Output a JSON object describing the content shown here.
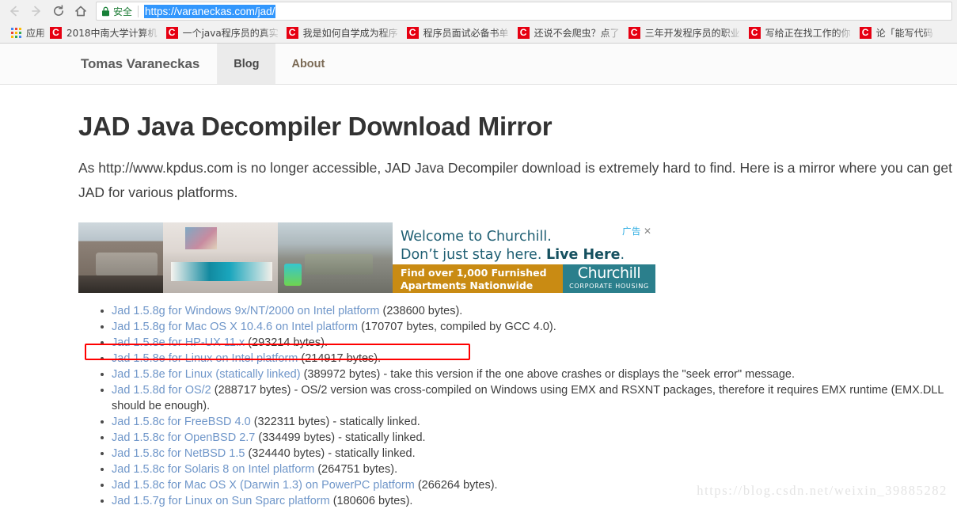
{
  "browser": {
    "toolbar": {
      "back_icon": "back-arrow-icon",
      "forward_icon": "forward-arrow-icon",
      "reload_icon": "reload-icon",
      "home_icon": "home-icon"
    },
    "omnibox": {
      "lock_icon": "lock-icon",
      "security_label": "安全",
      "url": "https://varaneckas.com/jad/",
      "url_selected": true
    },
    "bookmarks_bar": {
      "apps_icon": "apps-grid-icon",
      "apps_label": "应用",
      "items": [
        {
          "icon": "csdn-icon",
          "icon_letter": "C",
          "label": "2018中南大学计算机"
        },
        {
          "icon": "csdn-icon",
          "icon_letter": "C",
          "label": "一个java程序员的真实"
        },
        {
          "icon": "csdn-icon",
          "icon_letter": "C",
          "label": "我是如何自学成为程序"
        },
        {
          "icon": "csdn-icon",
          "icon_letter": "C",
          "label": "程序员面试必备书单"
        },
        {
          "icon": "csdn-icon",
          "icon_letter": "C",
          "label": "还说不会爬虫？点了"
        },
        {
          "icon": "csdn-icon",
          "icon_letter": "C",
          "label": "三年开发程序员的职业"
        },
        {
          "icon": "csdn-icon",
          "icon_letter": "C",
          "label": "写给正在找工作的你"
        },
        {
          "icon": "csdn-icon",
          "icon_letter": "C",
          "label": "论「能写代码"
        }
      ]
    }
  },
  "site": {
    "brand": "Tomas Varaneckas",
    "tabs": [
      {
        "label": "Blog",
        "active": true
      },
      {
        "label": "About",
        "active": false
      }
    ]
  },
  "page": {
    "title": "JAD Java Decompiler Download Mirror",
    "intro": "As http://www.kpdus.com is no longer accessible, JAD Java Decompiler download is extremely hard to find. Here is a mirror where you can get JAD for various platforms."
  },
  "ad": {
    "badge_label": "广告",
    "close_icon": "close-icon",
    "headline_1": "Welcome to Churchill.",
    "headline_2_plain": "Don’t just stay here. ",
    "headline_2_bold": "Live Here",
    "headline_2_end": ".",
    "tagline_1": "Find over 1,000 Furnished",
    "tagline_2": "Apartments Nationwide",
    "logo_name": "Churchill",
    "logo_sub": "CORPORATE HOUSING",
    "photos": [
      "living-room-photo",
      "bedroom-photo",
      "lounge-photo"
    ]
  },
  "downloads": [
    {
      "link": "Jad 1.5.8g for Windows 9x/NT/2000 on Intel platform",
      "rest": " (238600 bytes).",
      "highlighted": true,
      "nowrap": true
    },
    {
      "link": "Jad 1.5.8g for Mac OS X 10.4.6 on Intel platform",
      "rest": " (170707 bytes, compiled by GCC 4.0).",
      "highlighted": false,
      "nowrap": true
    },
    {
      "link": "Jad 1.5.8e for HP-UX 11.x",
      "rest": " (293214 bytes).",
      "highlighted": false,
      "nowrap": true
    },
    {
      "link": "Jad 1.5.8e for Linux on Intel platform",
      "rest": " (214917 bytes).",
      "highlighted": false,
      "nowrap": true
    },
    {
      "link": "Jad 1.5.8e for Linux (statically linked)",
      "rest": " (389972 bytes) - take this version if the one above crashes or displays the \"seek error\" message.",
      "highlighted": false,
      "nowrap": true
    },
    {
      "link": "Jad 1.5.8d for OS/2",
      "rest": " (288717 bytes) - OS/2 version was cross-compiled on Windows using EMX and RSXNT packages, therefore it requires EMX runtime (EMX.DLL should be enough).",
      "highlighted": false,
      "nowrap": false
    },
    {
      "link": "Jad 1.5.8c for FreeBSD 4.0",
      "rest": " (322311 bytes) - statically linked.",
      "highlighted": false,
      "nowrap": true
    },
    {
      "link": "Jad 1.5.8c for OpenBSD 2.7",
      "rest": " (334499 bytes) - statically linked.",
      "highlighted": false,
      "nowrap": true
    },
    {
      "link": "Jad 1.5.8c for NetBSD 1.5",
      "rest": " (324440 bytes) - statically linked.",
      "highlighted": false,
      "nowrap": true
    },
    {
      "link": "Jad 1.5.8c for Solaris 8 on Intel platform",
      "rest": " (264751 bytes).",
      "highlighted": false,
      "nowrap": true
    },
    {
      "link": "Jad 1.5.8c for Mac OS X (Darwin 1.3) on PowerPC platform",
      "rest": " (266264 bytes).",
      "highlighted": false,
      "nowrap": true
    },
    {
      "link": "Jad 1.5.7g for Linux on Sun Sparc platform",
      "rest": " (180606 bytes).",
      "highlighted": false,
      "nowrap": true
    }
  ],
  "watermark": "https://blog.csdn.net/weixin_39885282",
  "colors": {
    "link": "#6f96c9",
    "highlight_box": "#ff0000",
    "secure_green": "#1a7a33",
    "url_selection": "#3297fd",
    "csdn_red": "#e60012",
    "ad_badge": "#29abe2",
    "ad_tagline_bg": "#c98b13",
    "ad_logo_bg": "#2b7f8c"
  }
}
